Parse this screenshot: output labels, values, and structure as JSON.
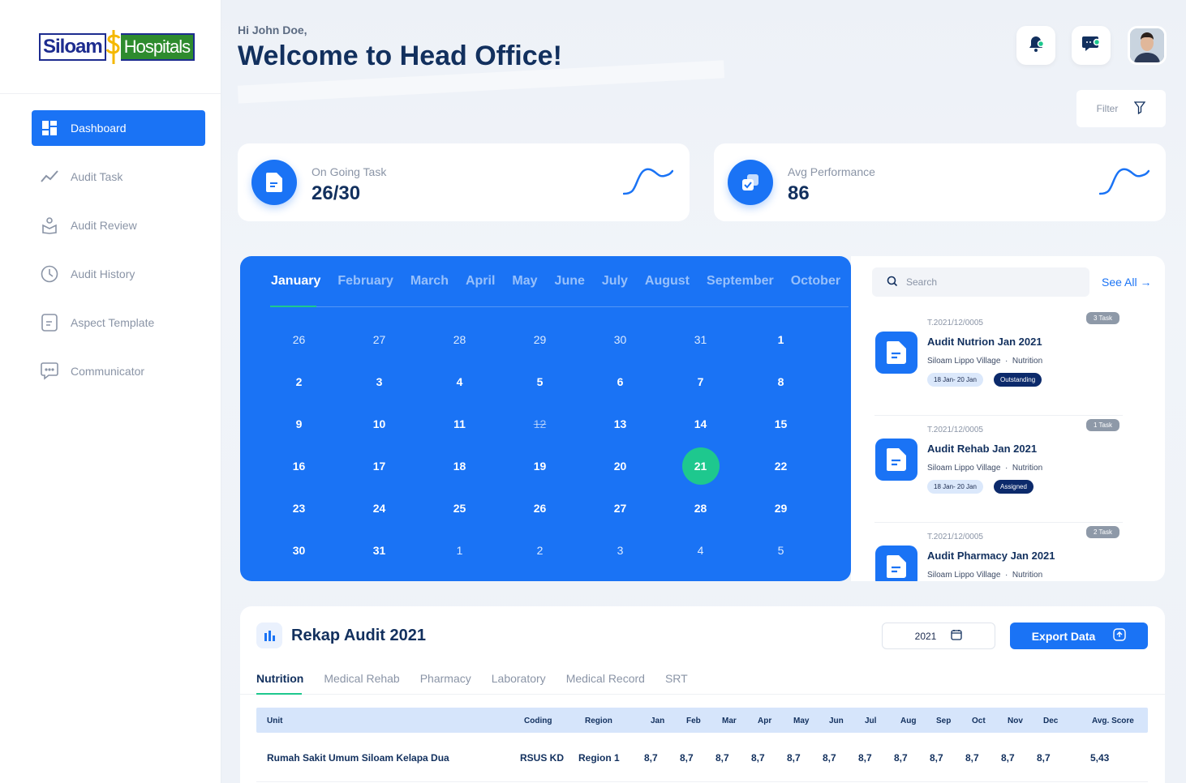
{
  "brand": {
    "part1": "Siloam",
    "part2": "Hospitals"
  },
  "nav": [
    {
      "label": "Dashboard",
      "icon": "dashboard-icon",
      "active": true
    },
    {
      "label": "Audit Task",
      "icon": "trend-icon"
    },
    {
      "label": "Audit Review",
      "icon": "review-icon"
    },
    {
      "label": "Audit History",
      "icon": "clock-icon"
    },
    {
      "label": "Aspect Template",
      "icon": "template-icon"
    },
    {
      "label": "Communicator",
      "icon": "chat-icon"
    }
  ],
  "header": {
    "greeting": "Hi John Doe,",
    "title": "Welcome to Head Office!",
    "filter_label": "Filter"
  },
  "stats": [
    {
      "label": "On Going Task",
      "value": "26/30"
    },
    {
      "label": "Avg Performance",
      "value": "86"
    }
  ],
  "calendar": {
    "months": [
      "January",
      "February",
      "March",
      "April",
      "May",
      "June",
      "July",
      "August",
      "September",
      "October"
    ],
    "active_month": "January",
    "days": [
      {
        "n": "26",
        "dim": true
      },
      {
        "n": "27",
        "dim": true
      },
      {
        "n": "28",
        "dim": true
      },
      {
        "n": "29",
        "dim": true
      },
      {
        "n": "30",
        "dim": true
      },
      {
        "n": "31",
        "dim": true
      },
      {
        "n": "1"
      },
      {
        "n": "2"
      },
      {
        "n": "3"
      },
      {
        "n": "4"
      },
      {
        "n": "5"
      },
      {
        "n": "6"
      },
      {
        "n": "7"
      },
      {
        "n": "8"
      },
      {
        "n": "9"
      },
      {
        "n": "10"
      },
      {
        "n": "11"
      },
      {
        "n": "12",
        "strike": true
      },
      {
        "n": "13"
      },
      {
        "n": "14"
      },
      {
        "n": "15"
      },
      {
        "n": "16"
      },
      {
        "n": "17"
      },
      {
        "n": "18"
      },
      {
        "n": "19"
      },
      {
        "n": "20"
      },
      {
        "n": "21",
        "today": true
      },
      {
        "n": "22"
      },
      {
        "n": "23"
      },
      {
        "n": "24"
      },
      {
        "n": "25"
      },
      {
        "n": "26"
      },
      {
        "n": "27"
      },
      {
        "n": "28"
      },
      {
        "n": "29"
      },
      {
        "n": "30"
      },
      {
        "n": "31"
      },
      {
        "n": "1",
        "dim": true
      },
      {
        "n": "2",
        "dim": true
      },
      {
        "n": "3",
        "dim": true
      },
      {
        "n": "4",
        "dim": true
      },
      {
        "n": "5",
        "dim": true
      }
    ]
  },
  "tasks": {
    "search_placeholder": "Search",
    "see_all": "See All →",
    "items": [
      {
        "code": "T.2021/12/0005",
        "badge": "3 Task",
        "name": "Audit Nutrion Jan 2021",
        "location": "Siloam Lippo Village",
        "dept": "Nutrition",
        "date": "18 Jan- 20 Jan",
        "status": "Outstanding"
      },
      {
        "code": "T.2021/12/0005",
        "badge": "1 Task",
        "name": "Audit Rehab Jan 2021",
        "location": "Siloam Lippo Village",
        "dept": "Nutrition",
        "date": "18 Jan- 20 Jan",
        "status": "Assigned"
      },
      {
        "code": "T.2021/12/0005",
        "badge": "2 Task",
        "name": "Audit Pharmacy Jan 2021",
        "location": "Siloam Lippo Village",
        "dept": "Nutrition",
        "date": "",
        "status": ""
      }
    ]
  },
  "rekap": {
    "title": "Rekap Audit 2021",
    "year": "2021",
    "export_label": "Export Data",
    "tabs": [
      "Nutrition",
      "Medical Rehab",
      "Pharmacy",
      "Laboratory",
      "Medical Record",
      "SRT"
    ],
    "columns": [
      "Unit",
      "Coding",
      "Region",
      "Jan",
      "Feb",
      "Mar",
      "Apr",
      "May",
      "Jun",
      "Jul",
      "Aug",
      "Sep",
      "Oct",
      "Nov",
      "Dec",
      "Avg. Score"
    ],
    "rows": [
      [
        "Rumah Sakit Umum Siloam Kelapa Dua",
        "RSUS KD",
        "Region 1",
        "8,7",
        "8,7",
        "8,7",
        "8,7",
        "8,7",
        "8,7",
        "8,7",
        "8,7",
        "8,7",
        "8,7",
        "8,7",
        "8,7",
        "5,43"
      ]
    ]
  }
}
